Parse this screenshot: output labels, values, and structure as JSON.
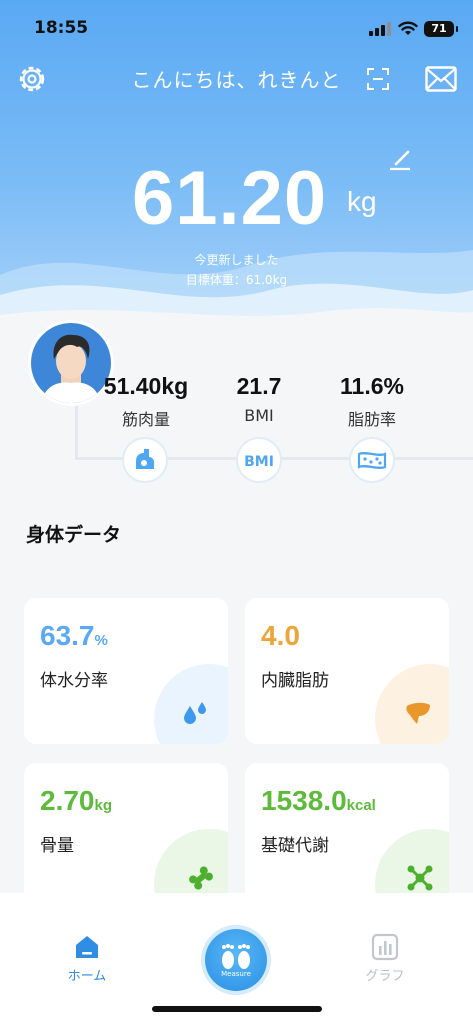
{
  "status_bar": {
    "time": "18:55",
    "battery": "71"
  },
  "header": {
    "greeting": "こんにちは、れきんと"
  },
  "weight": {
    "value": "61.20",
    "unit": "kg",
    "updated": "今更新しました",
    "target": "目標体重：61.0kg"
  },
  "metrics": [
    {
      "value": "51.40kg",
      "label": "筋肉量"
    },
    {
      "value": "21.7",
      "label": "BMI"
    },
    {
      "value": "11.6%",
      "label": "脂肪率"
    }
  ],
  "section": {
    "title": "身体データ"
  },
  "cards": [
    {
      "value": "63.7",
      "unit": "%",
      "label": "体水分率",
      "color": "#5aa9f4"
    },
    {
      "value": "4.0",
      "unit": "",
      "label": "内臓脂肪",
      "color": "#eda43a"
    },
    {
      "value": "2.70",
      "unit": "kg",
      "label": "骨量",
      "color": "#5dbb3c"
    },
    {
      "value": "1538.0",
      "unit": "kcal",
      "label": "基礎代謝",
      "color": "#5dbb3c"
    }
  ],
  "tabs": {
    "home": "ホーム",
    "measure": "Measure",
    "graph": "グラフ"
  },
  "colors": {
    "accent": "#2f8de4",
    "hero": "#5aa9f4"
  }
}
